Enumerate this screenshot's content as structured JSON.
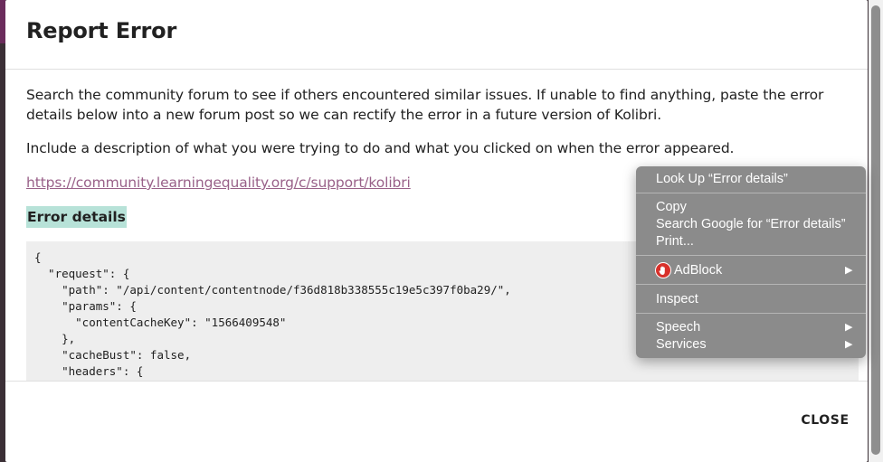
{
  "modal": {
    "title": "Report Error",
    "paragraph1": "Search the community forum to see if others encountered similar issues. If unable to find anything, paste the error details below into a new forum post so we can rectify the error in a future version of Kolibri.",
    "paragraph2": "Include a description of what you were trying to do and what you clicked on when the error appeared.",
    "forum_link": "https://community.learningequality.org/c/support/kolibri",
    "error_heading": "Error details",
    "code_lines": [
      "{",
      "  \"request\": {",
      "    \"path\": \"/api/content/contentnode/f36d818b338555c19e5c397f0ba29/\",",
      "    \"params\": {",
      "      \"contentCacheKey\": \"1566409548\"",
      "    },",
      "    \"cacheBust\": false,",
      "    \"headers\": {"
    ],
    "close_label": "CLOSE"
  },
  "context_menu": {
    "items": [
      {
        "label": "Look Up “Error details”"
      },
      {
        "label": "Copy"
      },
      {
        "label": "Search Google for “Error details”"
      },
      {
        "label": "Print..."
      },
      {
        "label": "AdBlock",
        "submenu": true
      },
      {
        "label": "Inspect"
      },
      {
        "label": "Speech",
        "submenu": true
      },
      {
        "label": "Services",
        "submenu": true
      }
    ],
    "submenu_arrow": "▶"
  },
  "colors": {
    "link": "#996189",
    "heading_highlight": "#b7e2d8",
    "code_background": "#eeeeee",
    "menu_background": "#8b8b8b",
    "adblock_red": "#d8312b"
  }
}
